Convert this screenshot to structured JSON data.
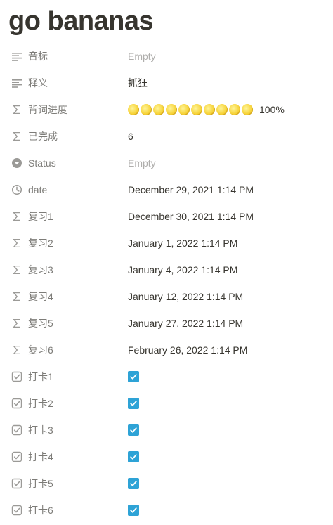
{
  "page": {
    "title": "go bananas"
  },
  "properties": [
    {
      "icon": "text-icon",
      "label": "音标",
      "value": "Empty",
      "empty": true
    },
    {
      "icon": "text-icon",
      "label": "释义",
      "value": "抓狂"
    },
    {
      "icon": "formula-icon",
      "label": "背词进度",
      "moons": 10,
      "progress_text": "100%",
      "progress": 1.0
    },
    {
      "icon": "formula-icon",
      "label": "已完成",
      "value": "6"
    },
    {
      "icon": "status-icon",
      "label": "Status",
      "value": "Empty",
      "empty": true
    },
    {
      "icon": "clock-icon",
      "label": "date",
      "value": "December 29, 2021 1:14 PM"
    },
    {
      "icon": "formula-icon",
      "label": "复习1",
      "value": "December 30, 2021 1:14 PM"
    },
    {
      "icon": "formula-icon",
      "label": "复习2",
      "value": "January 1, 2022 1:14 PM"
    },
    {
      "icon": "formula-icon",
      "label": "复习3",
      "value": "January 4, 2022 1:14 PM"
    },
    {
      "icon": "formula-icon",
      "label": "复习4",
      "value": "January 12, 2022 1:14 PM"
    },
    {
      "icon": "formula-icon",
      "label": "复习5",
      "value": "January 27, 2022 1:14 PM"
    },
    {
      "icon": "formula-icon",
      "label": "复习6",
      "value": "February 26, 2022 1:14 PM"
    },
    {
      "icon": "checkbox-icon",
      "label": "打卡1",
      "checked": true
    },
    {
      "icon": "checkbox-icon",
      "label": "打卡2",
      "checked": true
    },
    {
      "icon": "checkbox-icon",
      "label": "打卡3",
      "checked": true
    },
    {
      "icon": "checkbox-icon",
      "label": "打卡4",
      "checked": true
    },
    {
      "icon": "checkbox-icon",
      "label": "打卡5",
      "checked": true
    },
    {
      "icon": "checkbox-icon",
      "label": "打卡6",
      "checked": true
    }
  ],
  "colors": {
    "accent": "#2ea3d6",
    "text": "#37352f",
    "muted": "#9b9a97"
  }
}
